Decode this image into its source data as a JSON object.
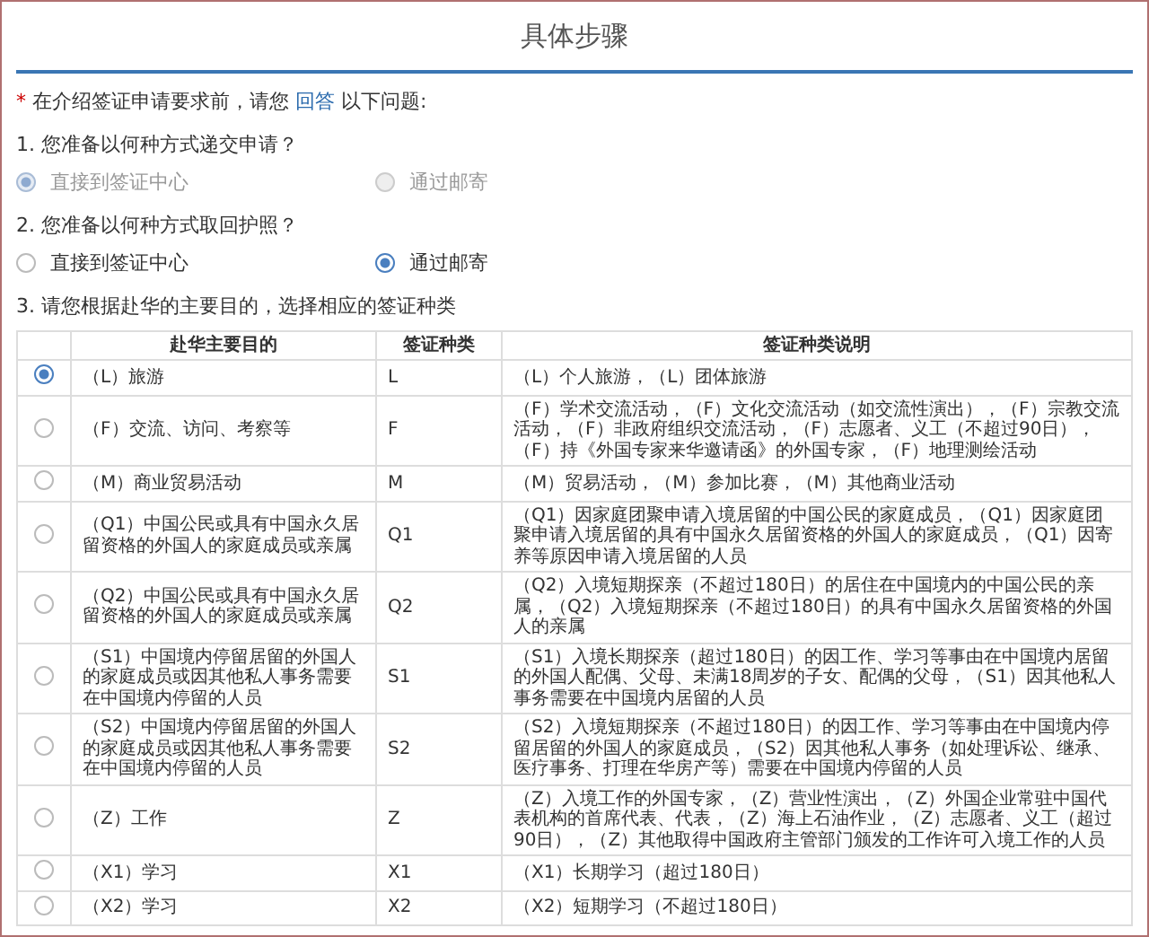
{
  "title": "具体步骤",
  "intro": {
    "required_mark": "*",
    "before": "在介绍签证申请要求前，请您",
    "link": "回答",
    "after": "以下问题:"
  },
  "questions": [
    {
      "label": "1. 您准备以何种方式递交申请？",
      "disabled": true,
      "options": [
        {
          "label": "直接到签证中心",
          "selected": true
        },
        {
          "label": "通过邮寄",
          "selected": false
        }
      ]
    },
    {
      "label": "2. 您准备以何种方式取回护照？",
      "disabled": false,
      "options": [
        {
          "label": "直接到签证中心",
          "selected": false
        },
        {
          "label": "通过邮寄",
          "selected": true
        }
      ]
    }
  ],
  "table_question": "3. 请您根据赴华的主要目的，选择相应的签证种类",
  "table": {
    "columns": [
      "赴华主要目的",
      "签证种类",
      "签证种类说明"
    ],
    "rows": [
      {
        "selected": true,
        "purpose": "（L）旅游",
        "type": "L",
        "description": "（L）个人旅游，（L）团体旅游"
      },
      {
        "selected": false,
        "purpose": "（F）交流、访问、考察等",
        "type": "F",
        "description": "（F）学术交流活动，（F）文化交流活动（如交流性演出），（F）宗教交流活动，（F）非政府组织交流活动，（F）志愿者、义工（不超过90日），（F）持《外国专家来华邀请函》的外国专家，（F）地理测绘活动"
      },
      {
        "selected": false,
        "purpose": "（M）商业贸易活动",
        "type": "M",
        "description": "（M）贸易活动，（M）参加比赛，（M）其他商业活动"
      },
      {
        "selected": false,
        "purpose": "（Q1）中国公民或具有中国永久居留资格的外国人的家庭成员或亲属",
        "type": "Q1",
        "description": "（Q1）因家庭团聚申请入境居留的中国公民的家庭成员，（Q1）因家庭团聚申请入境居留的具有中国永久居留资格的外国人的家庭成员，（Q1）因寄养等原因申请入境居留的人员"
      },
      {
        "selected": false,
        "purpose": "（Q2）中国公民或具有中国永久居留资格的外国人的家庭成员或亲属",
        "type": "Q2",
        "description": "（Q2）入境短期探亲（不超过180日）的居住在中国境内的中国公民的亲属，（Q2）入境短期探亲（不超过180日）的具有中国永久居留资格的外国人的亲属"
      },
      {
        "selected": false,
        "purpose": "（S1）中国境内停留居留的外国人的家庭成员或因其他私人事务需要在中国境内停留的人员",
        "type": "S1",
        "description": "（S1）入境长期探亲（超过180日）的因工作、学习等事由在中国境内居留的外国人配偶、父母、未满18周岁的子女、配偶的父母，（S1）因其他私人事务需要在中国境内居留的人员"
      },
      {
        "selected": false,
        "purpose": "（S2）中国境内停留居留的外国人的家庭成员或因其他私人事务需要在中国境内停留的人员",
        "type": "S2",
        "description": "（S2）入境短期探亲（不超过180日）的因工作、学习等事由在中国境内停留居留的外国人的家庭成员，（S2）因其他私人事务（如处理诉讼、继承、医疗事务、打理在华房产等）需要在中国境内停留的人员"
      },
      {
        "selected": false,
        "purpose": "（Z）工作",
        "type": "Z",
        "description": "（Z）入境工作的外国专家，（Z）营业性演出，（Z）外国企业常驻中国代表机构的首席代表、代表，（Z）海上石油作业，（Z）志愿者、义工（超过90日），（Z）其他取得中国政府主管部门颁发的工作许可入境工作的人员"
      },
      {
        "selected": false,
        "purpose": "（X1）学习",
        "type": "X1",
        "description": "（X1）长期学习（超过180日）"
      },
      {
        "selected": false,
        "purpose": "（X2）学习",
        "type": "X2",
        "description": "（X2）短期学习（不超过180日）"
      }
    ]
  }
}
